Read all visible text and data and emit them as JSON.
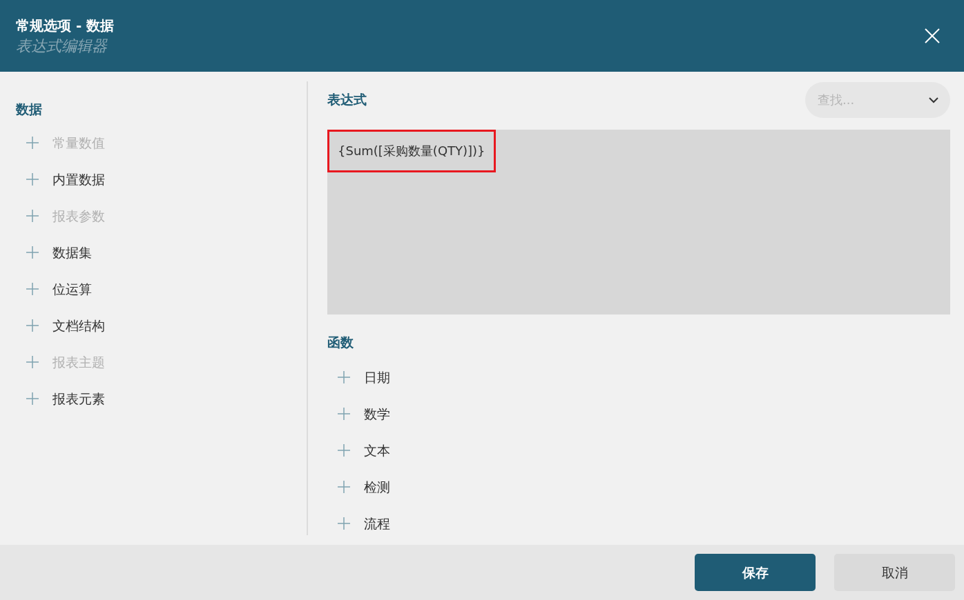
{
  "window": {
    "title": "常规选项 - 数据",
    "subtitle": "表达式编辑器"
  },
  "data_panel": {
    "heading": "数据",
    "items": [
      {
        "label": "常量数值",
        "disabled": true
      },
      {
        "label": "内置数据",
        "disabled": false
      },
      {
        "label": "报表参数",
        "disabled": true
      },
      {
        "label": "数据集",
        "disabled": false
      },
      {
        "label": "位运算",
        "disabled": false
      },
      {
        "label": "文档结构",
        "disabled": false
      },
      {
        "label": "报表主题",
        "disabled": true
      },
      {
        "label": "报表元素",
        "disabled": false
      }
    ]
  },
  "expression": {
    "heading": "表达式",
    "search": {
      "placeholder": "查找..."
    },
    "value": "{Sum([采购数量(QTY)])}",
    "highlighted": true
  },
  "functions": {
    "heading": "函数",
    "items": [
      {
        "label": "日期",
        "disabled": false
      },
      {
        "label": "数学",
        "disabled": false
      },
      {
        "label": "文本",
        "disabled": false
      },
      {
        "label": "检测",
        "disabled": false
      },
      {
        "label": "流程",
        "disabled": false
      }
    ]
  },
  "buttons": [
    {
      "label": "保存",
      "kind": "primary"
    },
    {
      "label": "取消",
      "kind": "secondary"
    }
  ]
}
